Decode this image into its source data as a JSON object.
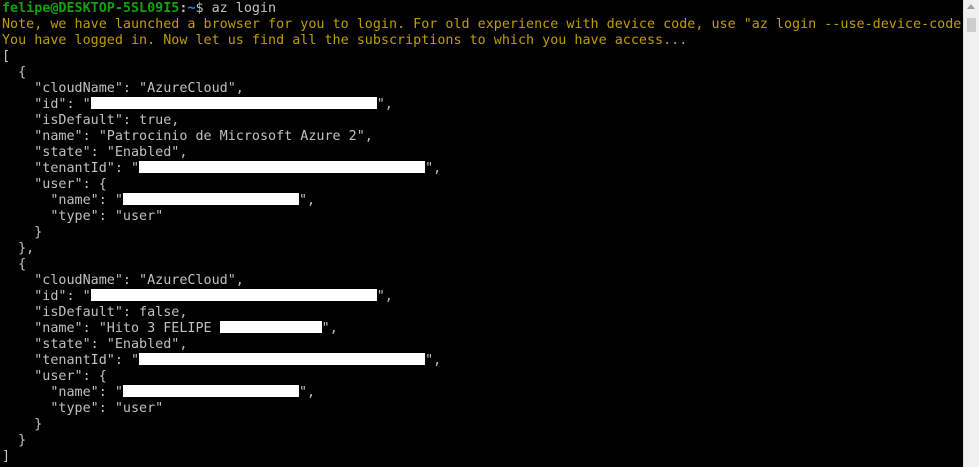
{
  "prompt": {
    "user_host": "felipe@DESKTOP-5SL09I5",
    "separator": ":",
    "path": "~",
    "dollar": "$",
    "command": " az login"
  },
  "messages": {
    "note": "Note, we have launched a browser for you to login. For old experience with device code, use \"az login --use-device-code\"",
    "logged_in": "You have logged in. Now let us find all the subscriptions to which you have access..."
  },
  "json_output": {
    "open_bracket": "[",
    "close_bracket": "]",
    "subscriptions": [
      {
        "open": "  {",
        "cloudName": "    \"cloudName\": \"AzureCloud\",",
        "id_key": "    \"id\": \"",
        "id_end": "\",",
        "isDefault": "    \"isDefault\": true,",
        "name_key": "    \"name\": \"Patrocinio de Microsoft Azure 2\",",
        "name_tail": "",
        "state": "    \"state\": \"Enabled\",",
        "tenant_key": "    \"tenantId\": \"",
        "tenant_end": "\",",
        "user_open": "    \"user\": {",
        "user_name_key": "      \"name\": \"",
        "user_name_end": "\",",
        "user_type": "      \"type\": \"user\"",
        "user_close": "    }",
        "close": "  },"
      },
      {
        "open": "  {",
        "cloudName": "    \"cloudName\": \"AzureCloud\",",
        "id_key": "    \"id\": \"",
        "id_end": "\",",
        "isDefault": "    \"isDefault\": false,",
        "name_key": "    \"name\": \"Hito 3 FELIPE ",
        "name_tail": "\",",
        "state": "    \"state\": \"Enabled\",",
        "tenant_key": "    \"tenantId\": \"",
        "tenant_end": "\",",
        "user_open": "    \"user\": {",
        "user_name_key": "      \"name\": \"",
        "user_name_end": "\",",
        "user_type": "      \"type\": \"user\"",
        "user_close": "    }",
        "close": "  }"
      }
    ]
  },
  "colors": {
    "background": "#000000",
    "text": "#c0c0c0",
    "prompt_user": "#13a10e",
    "prompt_path": "#3b78ff",
    "warning": "#c19c00",
    "redaction": "#ffffff"
  }
}
